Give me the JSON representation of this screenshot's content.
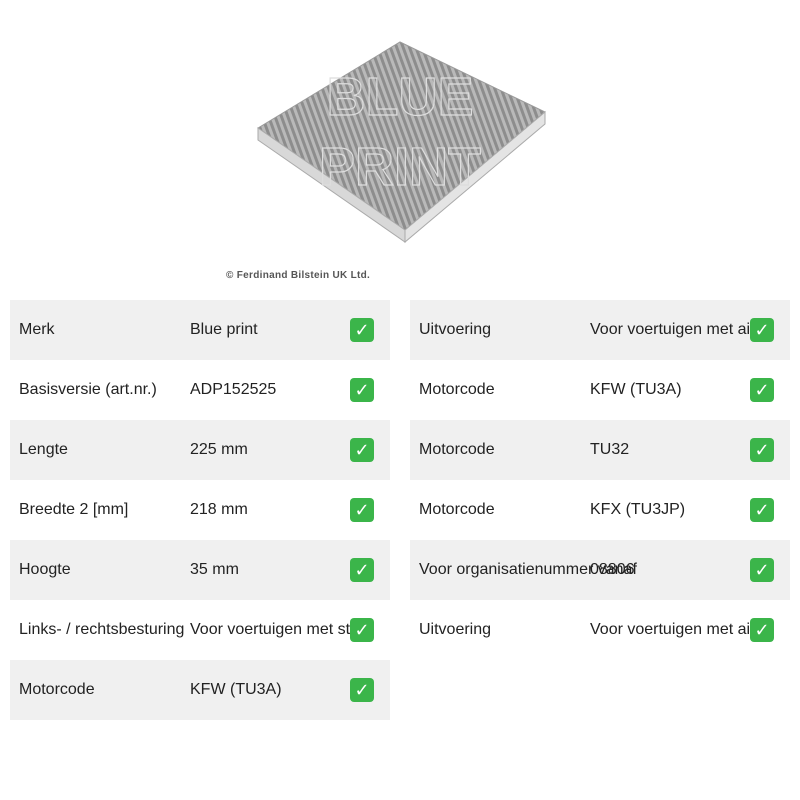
{
  "image": {
    "copyright": "© Ferdinand Bilstein UK Ltd.",
    "watermark": "BLUE PRINT"
  },
  "left_rows": [
    {
      "label": "Merk",
      "value": "Blue print",
      "check": "✓"
    },
    {
      "label": "Basisversie (art.nr.)",
      "value": "ADP152525",
      "check": "✓"
    },
    {
      "label": "Lengte",
      "value": "225 mm",
      "check": "✓"
    },
    {
      "label": "Breedte 2 [mm]",
      "value": "218 mm",
      "check": "✓"
    },
    {
      "label": "Hoogte",
      "value": "35 mm",
      "check": "✓"
    },
    {
      "label": "Links- / rechtsbesturing",
      "value": "Voor voertuigen met stuur",
      "check": "✓"
    },
    {
      "label": "Motorcode",
      "value": "KFW (TU3A)",
      "check": "✓"
    }
  ],
  "right_rows": [
    {
      "label": "Uitvoering",
      "value": "Voor voertuigen met airco",
      "check": "✓"
    },
    {
      "label": "Motorcode",
      "value": "KFW (TU3A)",
      "check": "✓"
    },
    {
      "label": "Motorcode",
      "value": "TU32",
      "check": "✓"
    },
    {
      "label": "Motorcode",
      "value": "KFX (TU3JP)",
      "check": "✓"
    },
    {
      "label": "Voor organisatienummer vanaf",
      "value": "08806",
      "check": "✓"
    },
    {
      "label": "Uitvoering",
      "value": "Voor voertuigen met airco",
      "check": "✓"
    }
  ]
}
